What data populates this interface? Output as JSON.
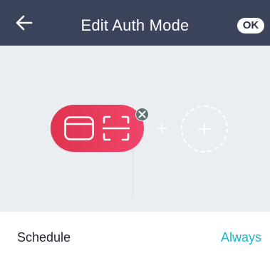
{
  "header": {
    "title": "Edit Auth Mode",
    "ok_label": "OK"
  },
  "auth_methods": {
    "selected": [
      "card-icon",
      "face-scan-icon"
    ],
    "add_slot_icon": "plus-icon"
  },
  "schedule": {
    "label": "Schedule",
    "value": "Always"
  },
  "colors": {
    "header_bg": "#3b435b",
    "canvas_bg": "#eaedf1",
    "pill_start": "#e0334f",
    "pill_end": "#f0456b",
    "remove_badge": "#5e7378",
    "accent_value": "#20b6c9"
  }
}
